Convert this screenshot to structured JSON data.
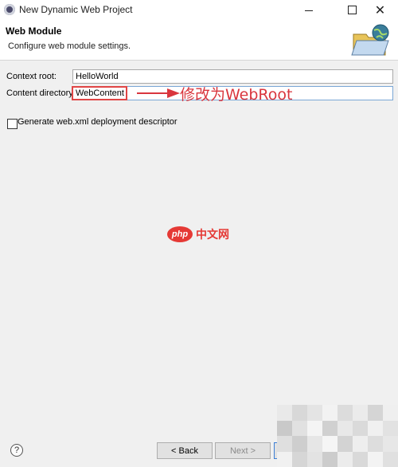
{
  "window": {
    "title": "New Dynamic Web Project"
  },
  "banner": {
    "title": "Web Module",
    "description": "Configure web module settings."
  },
  "form": {
    "context_root_label": "Context root:",
    "context_root_value": "HelloWorld",
    "content_directory_label": "Content directory:",
    "content_directory_value": "WebContent",
    "generate_label": "Generate web.xml deployment descriptor",
    "generate_checked": false
  },
  "annotation": {
    "text": "修改为WebRoot",
    "color": "#d9363e"
  },
  "watermark": {
    "logo": "php",
    "text": "中文网"
  },
  "buttons": {
    "help": "?",
    "back": "< Back",
    "next": "Next >"
  },
  "colors": {
    "highlight": "#e04646",
    "watermark": "#e53935",
    "accent": "#3c7fd6"
  }
}
